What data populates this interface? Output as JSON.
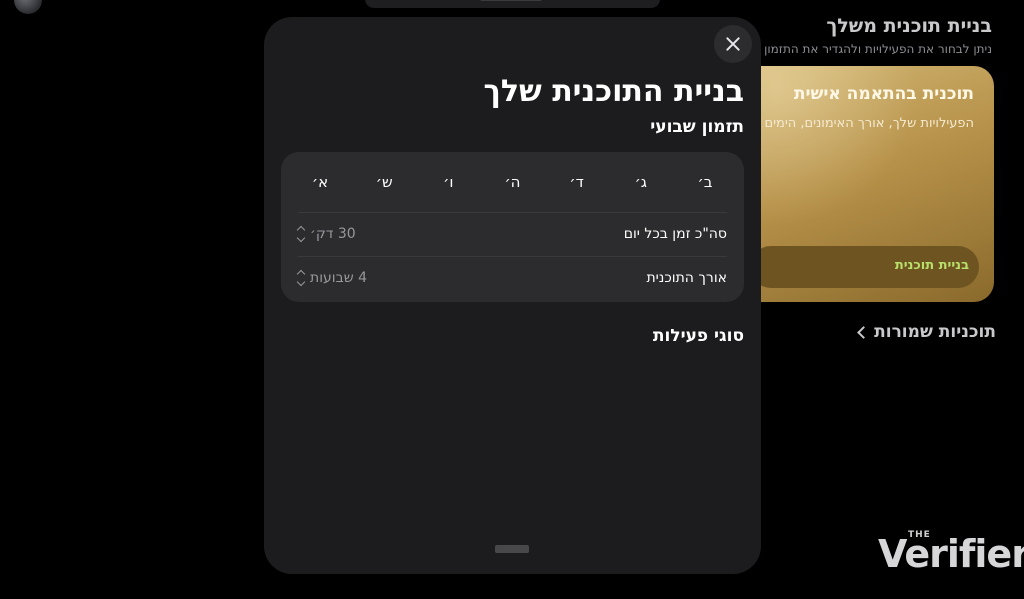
{
  "background": {
    "title": "בניית תוכנית משלך",
    "subtitle": "ניתן לבחור את הפעילויות ולהגדיר את התזמון",
    "card": {
      "title": "תוכנית בהתאמה אישית",
      "text": "הפעילויות שלך, אורך האימונים, הימים",
      "button_label": "בניית תוכנית"
    },
    "saved_plans_label": "תוכניות שמורות",
    "watermark": {
      "the": "THE",
      "name": "Verifier"
    }
  },
  "sheet": {
    "title": "בניית התוכנית שלך",
    "weekly_schedule_label": "תזמון שבועי",
    "days": [
      "ב׳",
      "ג׳",
      "ד׳",
      "ה׳",
      "ו׳",
      "ש׳",
      "א׳"
    ],
    "rows": [
      {
        "label": "סה\"כ זמן בכל יום",
        "value": "30 דק׳"
      },
      {
        "label": "אורך התוכנית",
        "value": "4 שבועות"
      }
    ],
    "activity_types_label": "סוגי פעילות"
  }
}
